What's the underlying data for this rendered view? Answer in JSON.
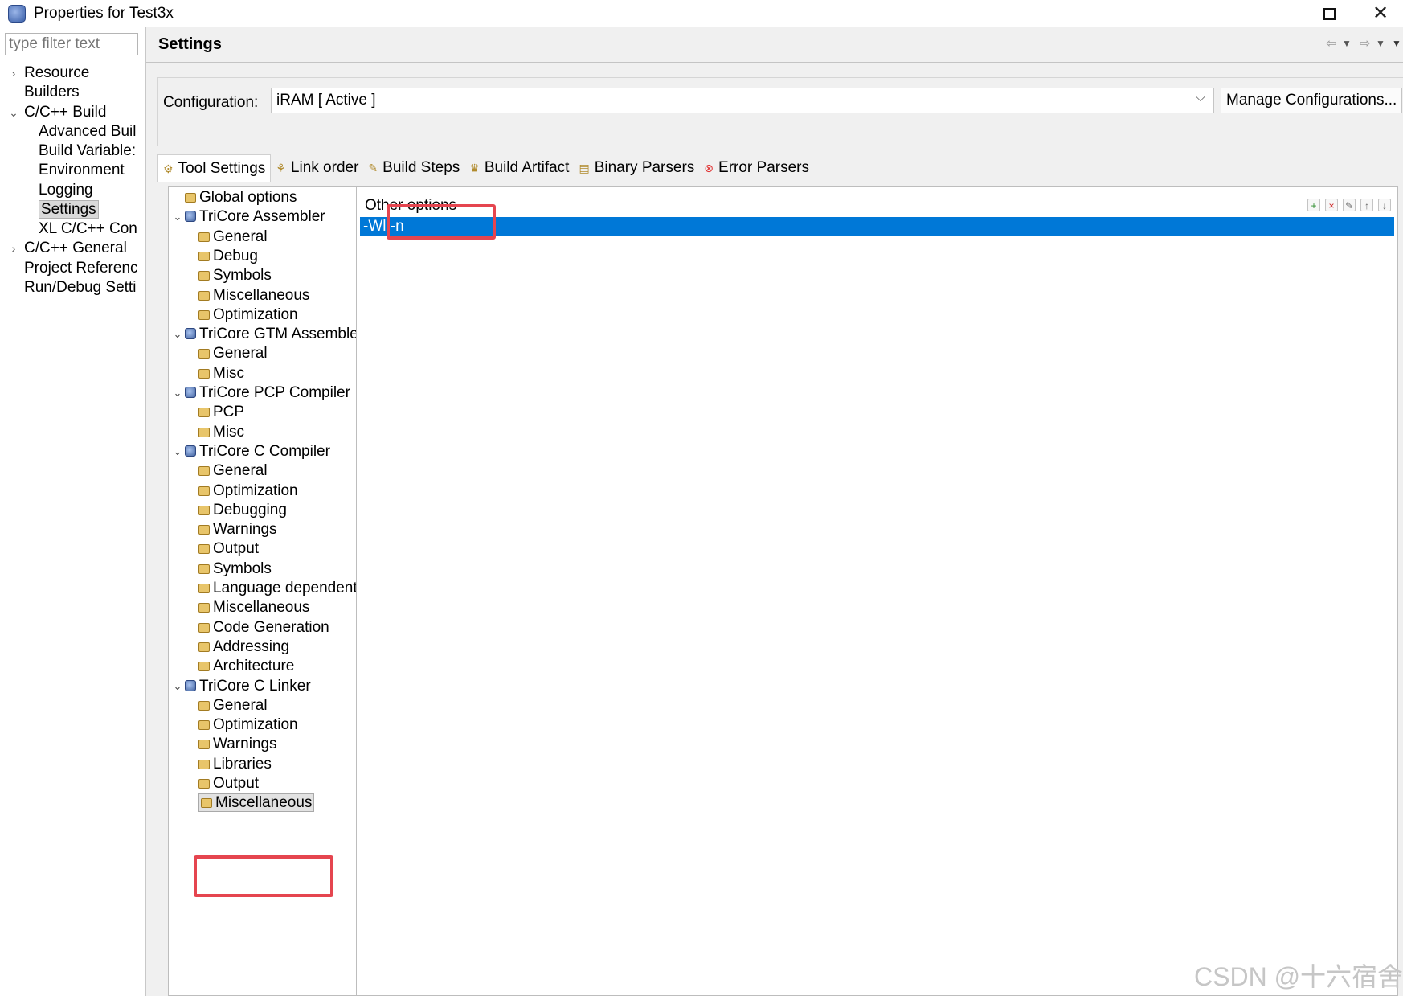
{
  "window": {
    "title": "Properties for Test3x",
    "icon": "eclipse-properties-icon"
  },
  "left_nav": {
    "filter_placeholder": "type filter text",
    "items": [
      {
        "label": "Resource",
        "expander": "collapsed"
      },
      {
        "label": "Builders"
      },
      {
        "label": "C/C++ Build",
        "expander": "expanded"
      },
      {
        "label": "Advanced Buil"
      },
      {
        "label": "Build Variable:"
      },
      {
        "label": "Environment"
      },
      {
        "label": "Logging"
      },
      {
        "label": "Settings",
        "selected": true
      },
      {
        "label": "XL C/C++ Con"
      },
      {
        "label": "C/C++ General",
        "expander": "collapsed"
      },
      {
        "label": "Project Referenc"
      },
      {
        "label": "Run/Debug Setti"
      }
    ]
  },
  "settings": {
    "title": "Settings",
    "history_icons": [
      "back-arrow-icon",
      "dropdown-icon",
      "forward-arrow-icon",
      "dropdown-icon",
      "menu-icon"
    ]
  },
  "configuration": {
    "label": "Configuration:",
    "value": "iRAM  [ Active ]",
    "manage_button": "Manage Configurations..."
  },
  "tabs": [
    {
      "label": "Tool Settings",
      "icon": "tool-settings-icon",
      "active": true
    },
    {
      "label": "Link order",
      "icon": "link-order-icon"
    },
    {
      "label": "Build Steps",
      "icon": "build-steps-icon"
    },
    {
      "label": "Build Artifact",
      "icon": "build-artifact-icon"
    },
    {
      "label": "Binary Parsers",
      "icon": "binary-parsers-icon"
    },
    {
      "label": "Error Parsers",
      "icon": "error-parsers-icon",
      "icon_color": "#e03030"
    }
  ],
  "tool_tree": [
    {
      "label": "Global options",
      "level": 0,
      "icon": "folder"
    },
    {
      "label": "TriCore Assembler",
      "level": 0,
      "icon": "tool",
      "expander": "expanded"
    },
    {
      "label": "General",
      "level": 1,
      "icon": "folder"
    },
    {
      "label": "Debug",
      "level": 1,
      "icon": "folder"
    },
    {
      "label": "Symbols",
      "level": 1,
      "icon": "folder"
    },
    {
      "label": "Miscellaneous",
      "level": 1,
      "icon": "folder"
    },
    {
      "label": "Optimization",
      "level": 1,
      "icon": "folder"
    },
    {
      "label": "TriCore GTM Assembler",
      "level": 0,
      "icon": "tool",
      "expander": "expanded"
    },
    {
      "label": "General",
      "level": 1,
      "icon": "folder"
    },
    {
      "label": "Misc",
      "level": 1,
      "icon": "folder"
    },
    {
      "label": "TriCore PCP Compiler",
      "level": 0,
      "icon": "tool",
      "expander": "expanded"
    },
    {
      "label": "PCP",
      "level": 1,
      "icon": "folder"
    },
    {
      "label": "Misc",
      "level": 1,
      "icon": "folder"
    },
    {
      "label": "TriCore C Compiler",
      "level": 0,
      "icon": "tool",
      "expander": "expanded"
    },
    {
      "label": "General",
      "level": 1,
      "icon": "folder"
    },
    {
      "label": "Optimization",
      "level": 1,
      "icon": "folder"
    },
    {
      "label": "Debugging",
      "level": 1,
      "icon": "folder"
    },
    {
      "label": "Warnings",
      "level": 1,
      "icon": "folder"
    },
    {
      "label": "Output",
      "level": 1,
      "icon": "folder"
    },
    {
      "label": "Symbols",
      "level": 1,
      "icon": "folder"
    },
    {
      "label": "Language dependent",
      "level": 1,
      "icon": "folder"
    },
    {
      "label": "Miscellaneous",
      "level": 1,
      "icon": "folder"
    },
    {
      "label": "Code Generation",
      "level": 1,
      "icon": "folder"
    },
    {
      "label": "Addressing",
      "level": 1,
      "icon": "folder"
    },
    {
      "label": "Architecture",
      "level": 1,
      "icon": "folder"
    },
    {
      "label": "TriCore C Linker",
      "level": 0,
      "icon": "tool",
      "expander": "expanded"
    },
    {
      "label": "General",
      "level": 1,
      "icon": "folder"
    },
    {
      "label": "Optimization",
      "level": 1,
      "icon": "folder"
    },
    {
      "label": "Warnings",
      "level": 1,
      "icon": "folder"
    },
    {
      "label": "Libraries",
      "level": 1,
      "icon": "folder"
    },
    {
      "label": "Output",
      "level": 1,
      "icon": "folder"
    },
    {
      "label": "Miscellaneous",
      "level": 1,
      "icon": "folder",
      "selected": true
    }
  ],
  "options_panel": {
    "label": "Other options",
    "toolbar_icons": [
      "add-icon",
      "delete-icon",
      "edit-icon",
      "move-up-icon",
      "move-down-icon"
    ],
    "rows": [
      "-Wl,-n"
    ],
    "selected_row_color": "#0078d7"
  },
  "annotation_color": "#e5454f",
  "watermark": "CSDN @十六宿舍"
}
